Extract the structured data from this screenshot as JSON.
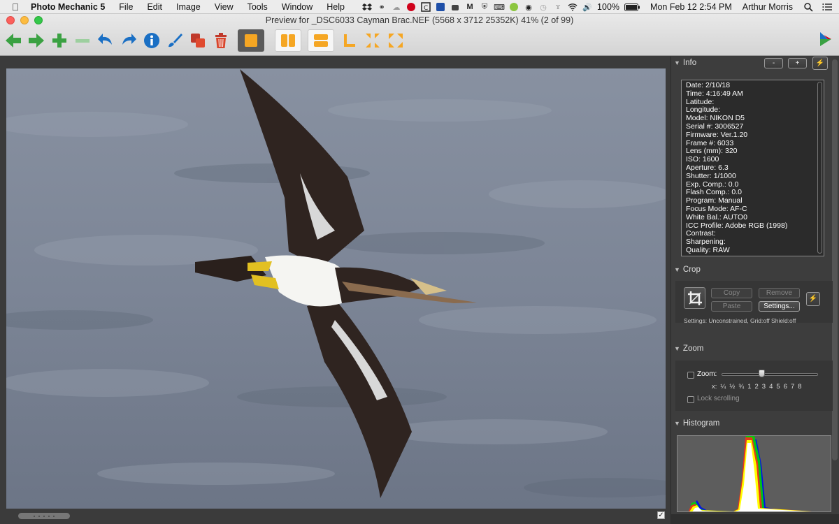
{
  "menubar": {
    "app_name": "Photo Mechanic 5",
    "menus": [
      "File",
      "Edit",
      "Image",
      "View",
      "Tools",
      "Window",
      "Help"
    ],
    "battery": "100%",
    "datetime": "Mon Feb 12  2:54 PM",
    "user": "Arthur Morris"
  },
  "window": {
    "title": "Preview for _DSC6033  Cayman Brac.NEF (5568 x 3712 25352K) 41% (2 of 99)"
  },
  "toolbar": {
    "items": [
      "arrow-left-icon",
      "arrow-right-icon",
      "plus-icon",
      "minus-icon",
      "undo-icon",
      "redo-icon",
      "info-icon",
      "brush-icon",
      "copy-stack-icon",
      "trash-icon",
      "single-view-icon",
      "split-vertical-icon",
      "split-horizontal-icon",
      "crop-corner-icon",
      "shrink-icon",
      "expand-icon"
    ]
  },
  "info_panel": {
    "title": "Info",
    "minus_label": "-",
    "plus_label": "+",
    "rows": [
      "Date: 2/10/18",
      "Time: 4:16:49 AM",
      "Latitude:",
      "Longitude:",
      "Model: NIKON D5",
      "Serial #: 3006527",
      "Firmware: Ver.1.20",
      "Frame #: 6033",
      "Lens (mm): 320",
      "ISO: 1600",
      "Aperture: 6.3",
      "Shutter: 1/1000",
      "Exp. Comp.: 0.0",
      "Flash Comp.: 0.0",
      "Program: Manual",
      "Focus Mode: AF-C",
      "White Bal.: AUTO0",
      "ICC Profile: Adobe RGB (1998)",
      "Contrast:",
      "Sharpening:",
      "Quality: RAW"
    ]
  },
  "crop_panel": {
    "title": "Crop",
    "copy_label": "Copy",
    "remove_label": "Remove",
    "paste_label": "Paste",
    "settings_label": "Settings...",
    "settings_text": "Settings:  Unconstrained, Grid:off Shield:off"
  },
  "zoom_panel": {
    "title": "Zoom",
    "zoom_label": "Zoom:",
    "ticks": [
      "x:",
      "¼",
      "½",
      "¾",
      "1",
      "2",
      "3",
      "4",
      "5",
      "6",
      "7",
      "8"
    ],
    "slider_fraction": 0.41,
    "lock_label": "Lock scrolling"
  },
  "histogram_panel": {
    "title": "Histogram"
  },
  "colors": {
    "accent_orange": "#f5a623",
    "toolbar_green": "#3aa142",
    "toolbar_blue": "#1a6fc4"
  }
}
